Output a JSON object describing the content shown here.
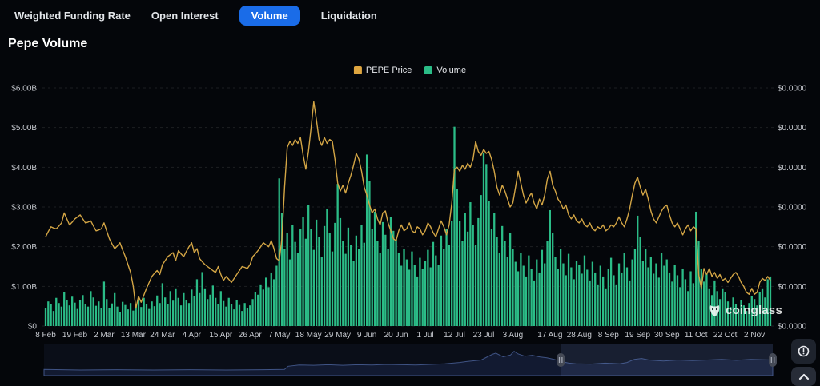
{
  "tabs": {
    "items": [
      {
        "label": "Weighted Funding Rate",
        "active": false
      },
      {
        "label": "Open Interest",
        "active": false
      },
      {
        "label": "Volume",
        "active": true
      },
      {
        "label": "Liquidation",
        "active": false
      }
    ]
  },
  "page": {
    "title": "Pepe Volume"
  },
  "legend": {
    "items": [
      {
        "label": "PEPE Price",
        "color": "#dfa640"
      },
      {
        "label": "Volume",
        "color": "#2bbc87"
      }
    ]
  },
  "axes": {
    "left_labels": [
      "$6.00B",
      "$5.00B",
      "$4.00B",
      "$3.00B",
      "$2.00B",
      "$1.00B",
      "$0"
    ],
    "right_labels": [
      "$0.0000",
      "$0.0000",
      "$0.0000",
      "$0.0000",
      "$0.0000",
      "$0.0000",
      "$0.0000"
    ],
    "x_labels": [
      "8 Feb",
      "19 Feb",
      "2 Mar",
      "13 Mar",
      "24 Mar",
      "4 Apr",
      "15 Apr",
      "26 Apr",
      "7 May",
      "18 May",
      "29 May",
      "9 Jun",
      "20 Jun",
      "1 Jul",
      "12 Jul",
      "23 Jul",
      "3 Aug",
      "17 Aug",
      "28 Aug",
      "8 Sep",
      "19 Sep",
      "30 Sep",
      "11 Oct",
      "22 Oct",
      "2 Nov"
    ]
  },
  "watermark": {
    "text": "coinglass"
  },
  "colors": {
    "background": "#04060a",
    "accent_blue": "#1a6ce8",
    "bar_green": "#2bbc87",
    "line_gold": "#d3a545",
    "axis_text": "#c7cad0",
    "grid": "rgba(255,255,255,0.10)",
    "nav_bg": "#0a0e18",
    "nav_fill": "#121a31",
    "nav_stroke": "#3f5384",
    "nav_selection": "rgba(98,122,182,0.16)",
    "handle": "#454a56",
    "handle_grip": "#a9afbb"
  },
  "chart_data": {
    "type": "bar",
    "title": "Pepe Volume",
    "x": {
      "start_date": "8 Feb",
      "end_date": "8 Nov",
      "points": 274,
      "tick_labels": [
        "8 Feb",
        "19 Feb",
        "2 Mar",
        "13 Mar",
        "24 Mar",
        "4 Apr",
        "15 Apr",
        "26 Apr",
        "7 May",
        "18 May",
        "29 May",
        "9 Jun",
        "20 Jun",
        "1 Jul",
        "12 Jul",
        "23 Jul",
        "3 Aug",
        "17 Aug",
        "28 Aug",
        "8 Sep",
        "19 Sep",
        "30 Sep",
        "11 Oct",
        "22 Oct",
        "2 Nov"
      ],
      "tick_day_indices": [
        0,
        11,
        22,
        33,
        44,
        55,
        66,
        77,
        88,
        99,
        110,
        121,
        132,
        143,
        154,
        165,
        176,
        190,
        201,
        212,
        223,
        234,
        245,
        256,
        267
      ]
    },
    "ylim_left": [
      0,
      6
    ],
    "left_axis_unit": "billion USD",
    "right_axis_tick_text": "$0.0000",
    "grid": "dashed horizontal",
    "legend_position": "top-center",
    "series": [
      {
        "name": "Volume",
        "type": "bar",
        "axis": "left",
        "color": "#2bbc87",
        "values": [
          0.45,
          0.62,
          0.55,
          0.38,
          0.71,
          0.58,
          0.49,
          0.85,
          0.66,
          0.52,
          0.74,
          0.59,
          0.43,
          0.66,
          0.78,
          0.55,
          0.49,
          0.88,
          0.72,
          0.51,
          0.62,
          0.45,
          1.12,
          0.68,
          0.45,
          0.57,
          0.83,
          0.49,
          0.36,
          0.61,
          0.53,
          0.42,
          0.58,
          0.39,
          0.52,
          0.66,
          0.48,
          0.71,
          0.55,
          0.43,
          0.62,
          0.5,
          0.77,
          0.58,
          1.08,
          0.72,
          0.56,
          0.88,
          0.64,
          0.95,
          0.71,
          0.52,
          0.83,
          0.66,
          0.58,
          0.92,
          0.75,
          1.18,
          0.83,
          1.36,
          0.95,
          0.68,
          0.79,
          1.02,
          0.71,
          0.55,
          0.88,
          0.63,
          0.49,
          0.71,
          0.56,
          0.42,
          0.65,
          0.53,
          0.38,
          0.58,
          0.45,
          0.52,
          0.68,
          0.85,
          0.79,
          1.05,
          0.92,
          1.22,
          0.98,
          1.35,
          1.18,
          1.52,
          3.72,
          2.85,
          1.95,
          2.35,
          1.68,
          2.55,
          2.12,
          1.85,
          2.45,
          2.75,
          2.2,
          3.05,
          2.45,
          1.92,
          2.68,
          2.25,
          1.75,
          2.52,
          2.95,
          2.35,
          1.88,
          2.6,
          3.58,
          2.72,
          2.15,
          1.82,
          2.48,
          2.05,
          1.65,
          2.28,
          1.95,
          2.55,
          2.1,
          4.32,
          3.65,
          2.45,
          2.88,
          2.15,
          1.85,
          2.62,
          2.3,
          1.95,
          2.75,
          2.4,
          2.18,
          1.85,
          1.52,
          1.95,
          1.68,
          1.42,
          1.88,
          1.55,
          1.25,
          1.72,
          1.45,
          1.65,
          1.92,
          1.48,
          2.12,
          1.78,
          1.55,
          2.28,
          1.95,
          2.45,
          2.05,
          2.65,
          5.02,
          3.45,
          2.65,
          2.15,
          2.85,
          2.38,
          3.12,
          2.55,
          2.05,
          2.72,
          3.3,
          4.35,
          4.08,
          3.15,
          2.45,
          2.85,
          2.25,
          1.85,
          2.52,
          2.15,
          1.75,
          2.35,
          1.95,
          1.62,
          1.38,
          1.85,
          1.52,
          1.25,
          1.78,
          1.45,
          1.15,
          1.68,
          1.35,
          1.92,
          1.58,
          2.15,
          2.92,
          2.35,
          1.75,
          1.45,
          1.95,
          1.58,
          1.28,
          1.82,
          1.48,
          1.18,
          1.65,
          1.55,
          1.32,
          1.78,
          1.42,
          1.15,
          1.62,
          1.35,
          1.05,
          1.52,
          1.25,
          0.95,
          1.45,
          1.72,
          1.28,
          1.05,
          1.58,
          1.35,
          1.85,
          1.48,
          1.15,
          1.68,
          1.95,
          2.78,
          2.25,
          1.65,
          1.95,
          1.48,
          1.75,
          1.32,
          1.58,
          1.22,
          1.85,
          1.52,
          1.68,
          1.35,
          1.12,
          1.55,
          1.28,
          0.98,
          1.45,
          1.18,
          0.88,
          1.38,
          1.08,
          2.88,
          2.15,
          1.45,
          1.12,
          1.35,
          0.95,
          0.78,
          1.15,
          0.88,
          0.68,
          0.95,
          0.85,
          0.62,
          0.48,
          0.72,
          0.55,
          0.42,
          0.65,
          0.52,
          0.38,
          0.58,
          0.75,
          0.68,
          0.52,
          0.85,
          0.95,
          0.72,
          1.18,
          1.25
        ]
      },
      {
        "name": "PEPE Price",
        "type": "line",
        "axis": "right",
        "color": "#d3a545",
        "scale": "plotted-in-left-axis-$B-equivalent",
        "values": [
          2.25,
          2.38,
          2.5,
          2.47,
          2.45,
          2.52,
          2.6,
          2.85,
          2.7,
          2.55,
          2.62,
          2.7,
          2.75,
          2.8,
          2.7,
          2.6,
          2.62,
          2.65,
          2.52,
          2.4,
          2.42,
          2.45,
          2.6,
          2.4,
          2.2,
          2.07,
          1.95,
          2.02,
          2.1,
          1.92,
          1.75,
          1.55,
          1.35,
          1.0,
          0.45,
          0.75,
          0.6,
          0.78,
          0.95,
          1.1,
          1.25,
          1.33,
          1.4,
          1.3,
          1.55,
          1.65,
          1.75,
          1.8,
          1.85,
          1.65,
          1.9,
          1.82,
          1.75,
          1.88,
          2.0,
          2.1,
          1.85,
          1.95,
          1.7,
          1.62,
          1.55,
          1.5,
          1.45,
          1.4,
          1.35,
          1.5,
          1.3,
          1.15,
          1.25,
          1.18,
          1.1,
          1.2,
          1.3,
          1.4,
          1.5,
          1.48,
          1.45,
          1.55,
          1.75,
          1.82,
          1.9,
          2.0,
          2.1,
          2.05,
          2.0,
          2.15,
          1.95,
          1.7,
          1.65,
          2.2,
          3.5,
          4.5,
          4.65,
          4.55,
          4.7,
          4.6,
          4.75,
          4.3,
          3.95,
          4.4,
          5.0,
          5.65,
          5.2,
          4.7,
          4.55,
          4.75,
          4.6,
          4.7,
          4.65,
          4.2,
          3.6,
          3.4,
          3.55,
          3.35,
          3.6,
          3.8,
          4.05,
          4.35,
          4.2,
          3.9,
          3.5,
          3.3,
          3.05,
          2.85,
          2.95,
          2.7,
          2.55,
          2.85,
          2.9,
          2.6,
          2.4,
          2.2,
          2.15,
          2.4,
          2.55,
          2.4,
          2.45,
          2.6,
          2.4,
          2.35,
          2.5,
          2.45,
          2.3,
          2.4,
          2.6,
          2.5,
          2.35,
          2.25,
          2.45,
          2.65,
          2.5,
          2.3,
          2.55,
          3.1,
          3.95,
          4.0,
          3.9,
          4.05,
          3.95,
          4.1,
          4.0,
          4.2,
          4.65,
          4.4,
          4.3,
          4.45,
          4.35,
          4.4,
          4.2,
          3.9,
          3.5,
          3.3,
          3.55,
          3.4,
          3.2,
          3.0,
          3.1,
          3.5,
          3.9,
          3.6,
          3.3,
          3.1,
          3.25,
          3.35,
          3.1,
          2.95,
          3.2,
          3.05,
          3.3,
          3.7,
          3.9,
          3.55,
          3.4,
          3.2,
          3.1,
          2.95,
          3.05,
          2.8,
          2.7,
          2.8,
          2.65,
          2.6,
          2.7,
          2.55,
          2.5,
          2.6,
          2.45,
          2.4,
          2.5,
          2.45,
          2.55,
          2.4,
          2.45,
          2.55,
          2.5,
          2.6,
          2.75,
          2.6,
          2.5,
          2.7,
          2.95,
          3.3,
          3.6,
          3.75,
          3.5,
          3.3,
          3.45,
          3.2,
          2.9,
          2.7,
          2.6,
          2.75,
          2.9,
          3.0,
          3.05,
          2.8,
          2.6,
          2.5,
          2.6,
          2.45,
          2.3,
          2.45,
          2.55,
          2.4,
          2.5,
          2.45,
          1.3,
          0.95,
          1.45,
          1.3,
          1.45,
          1.25,
          1.35,
          1.2,
          1.3,
          1.15,
          1.2,
          1.1,
          1.2,
          1.3,
          1.35,
          1.25,
          1.1,
          1.0,
          0.85,
          0.8,
          0.95,
          0.8,
          0.85,
          1.1,
          1.2,
          1.15,
          1.25,
          1.15
        ]
      }
    ]
  },
  "navigator": {
    "selection": [
      0.709,
      1.0
    ],
    "points": [
      [
        0,
        0.2
      ],
      [
        0.05,
        0.18
      ],
      [
        0.1,
        0.19
      ],
      [
        0.15,
        0.18
      ],
      [
        0.2,
        0.19
      ],
      [
        0.25,
        0.18
      ],
      [
        0.3,
        0.19
      ],
      [
        0.33,
        0.2
      ],
      [
        0.335,
        0.3
      ],
      [
        0.35,
        0.34
      ],
      [
        0.37,
        0.33
      ],
      [
        0.39,
        0.35
      ],
      [
        0.41,
        0.33
      ],
      [
        0.43,
        0.35
      ],
      [
        0.45,
        0.34
      ],
      [
        0.47,
        0.36
      ],
      [
        0.49,
        0.35
      ],
      [
        0.51,
        0.34
      ],
      [
        0.53,
        0.36
      ],
      [
        0.55,
        0.38
      ],
      [
        0.57,
        0.42
      ],
      [
        0.58,
        0.45
      ],
      [
        0.6,
        0.5
      ],
      [
        0.615,
        0.68
      ],
      [
        0.62,
        0.72
      ],
      [
        0.63,
        0.6
      ],
      [
        0.64,
        0.66
      ],
      [
        0.645,
        0.78
      ],
      [
        0.65,
        0.7
      ],
      [
        0.66,
        0.62
      ],
      [
        0.67,
        0.65
      ],
      [
        0.68,
        0.6
      ],
      [
        0.69,
        0.57
      ],
      [
        0.7,
        0.52
      ],
      [
        0.71,
        0.45
      ],
      [
        0.72,
        0.4
      ],
      [
        0.73,
        0.38
      ],
      [
        0.75,
        0.37
      ],
      [
        0.77,
        0.4
      ],
      [
        0.79,
        0.38
      ],
      [
        0.8,
        0.42
      ],
      [
        0.81,
        0.52
      ],
      [
        0.82,
        0.55
      ],
      [
        0.83,
        0.5
      ],
      [
        0.85,
        0.47
      ],
      [
        0.87,
        0.5
      ],
      [
        0.89,
        0.48
      ],
      [
        0.91,
        0.5
      ],
      [
        0.93,
        0.52
      ],
      [
        0.95,
        0.49
      ],
      [
        0.97,
        0.52
      ],
      [
        1.0,
        0.5
      ]
    ]
  }
}
